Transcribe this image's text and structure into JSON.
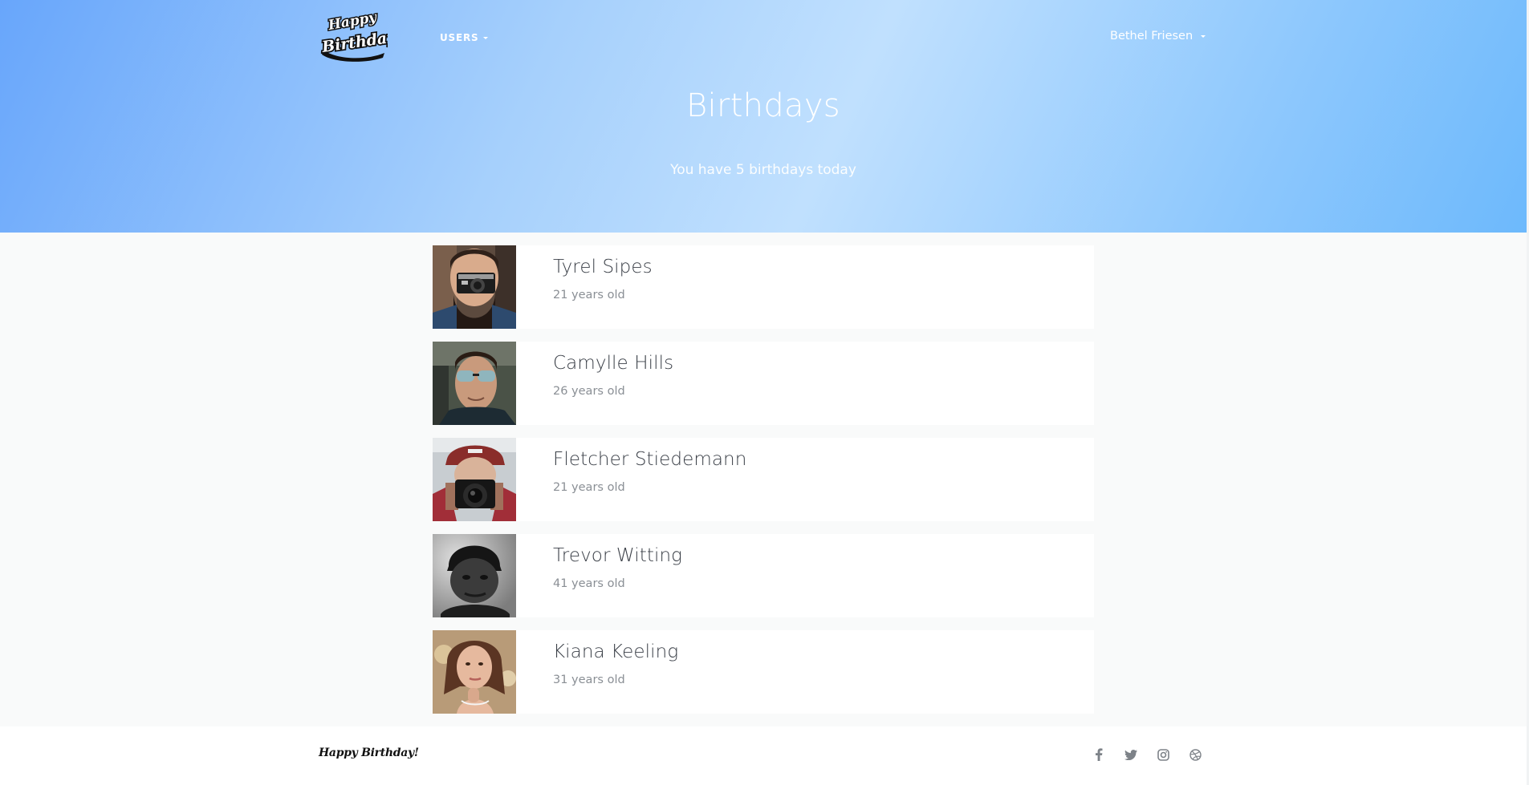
{
  "header": {
    "logo_alt": "Happy Birthday",
    "logo_line1": "Happy",
    "logo_line2": "Birthday",
    "nav_users_label": "USERS",
    "user_name": "Bethel Friesen"
  },
  "hero": {
    "title": "Birthdays",
    "subtitle": "You have 5 birthdays today"
  },
  "birthdays": [
    {
      "name": "Tyrel Sipes",
      "age": "21 years old",
      "photo": "man-with-camera"
    },
    {
      "name": "Camylle Hills",
      "age": "26 years old",
      "photo": "man-with-sunglasses"
    },
    {
      "name": "Fletcher Stiedemann",
      "age": "21 years old",
      "photo": "man-with-camera-cap"
    },
    {
      "name": "Trevor Witting",
      "age": "41 years old",
      "photo": "man-with-beanie"
    },
    {
      "name": "Kiana Keeling",
      "age": "31 years old",
      "photo": "woman-portrait"
    }
  ],
  "footer": {
    "brand": "Happy Birthday!",
    "social": [
      "facebook-icon",
      "twitter-icon",
      "instagram-icon",
      "dribbble-icon"
    ]
  },
  "colors": {
    "hero_gradient": [
      "#68a6fb",
      "#c0e0fe",
      "#6db9fc"
    ],
    "name_text": "#3a3f47",
    "age_text": "#8a8f95",
    "icon_gray": "#7d8288"
  }
}
